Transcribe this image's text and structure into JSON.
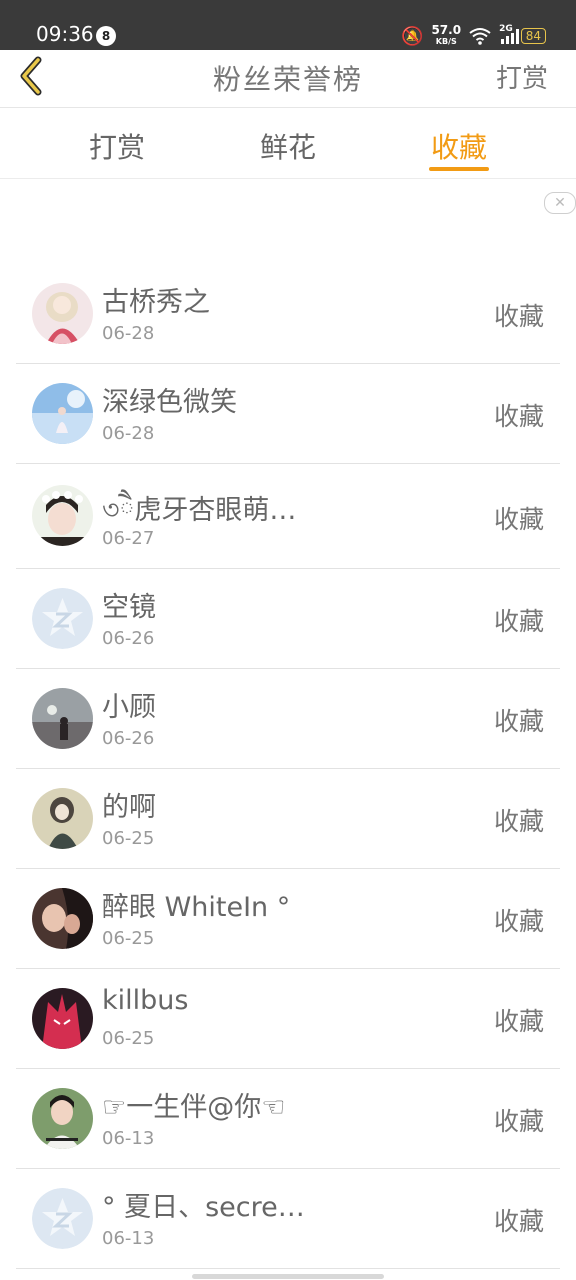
{
  "status": {
    "time": "09:36",
    "notification_count": "8",
    "net_speed": "57.0",
    "net_unit": "KB/S",
    "network_type": "2G",
    "battery": "84"
  },
  "nav": {
    "title": "粉丝荣誉榜",
    "action": "打赏"
  },
  "tabs": [
    "打赏",
    "鲜花",
    "收藏"
  ],
  "active_tab": "收藏",
  "accent_color": "#f29b14",
  "list": [
    {
      "name": "古桥秀之",
      "date": "06-28",
      "action": "收藏"
    },
    {
      "name": "深绿色微笑",
      "date": "06-28",
      "action": "收藏"
    },
    {
      "name": "৩ཻ虎牙杏眼萌…",
      "date": "06-27",
      "action": "收藏"
    },
    {
      "name": "空镜",
      "date": "06-26",
      "action": "收藏"
    },
    {
      "name": "小顾",
      "date": "06-26",
      "action": "收藏"
    },
    {
      "name": "的啊",
      "date": "06-25",
      "action": "收藏"
    },
    {
      "name": "醉眼  WhiteIn  °",
      "date": "06-25",
      "action": "收藏"
    },
    {
      "name": "killbus",
      "date": "06-25",
      "action": "收藏"
    },
    {
      "name": "☞一生伴@你☜",
      "date": "06-13",
      "action": "收藏"
    },
    {
      "name": "°  夏日、secre…",
      "date": "06-13",
      "action": "收藏"
    }
  ]
}
